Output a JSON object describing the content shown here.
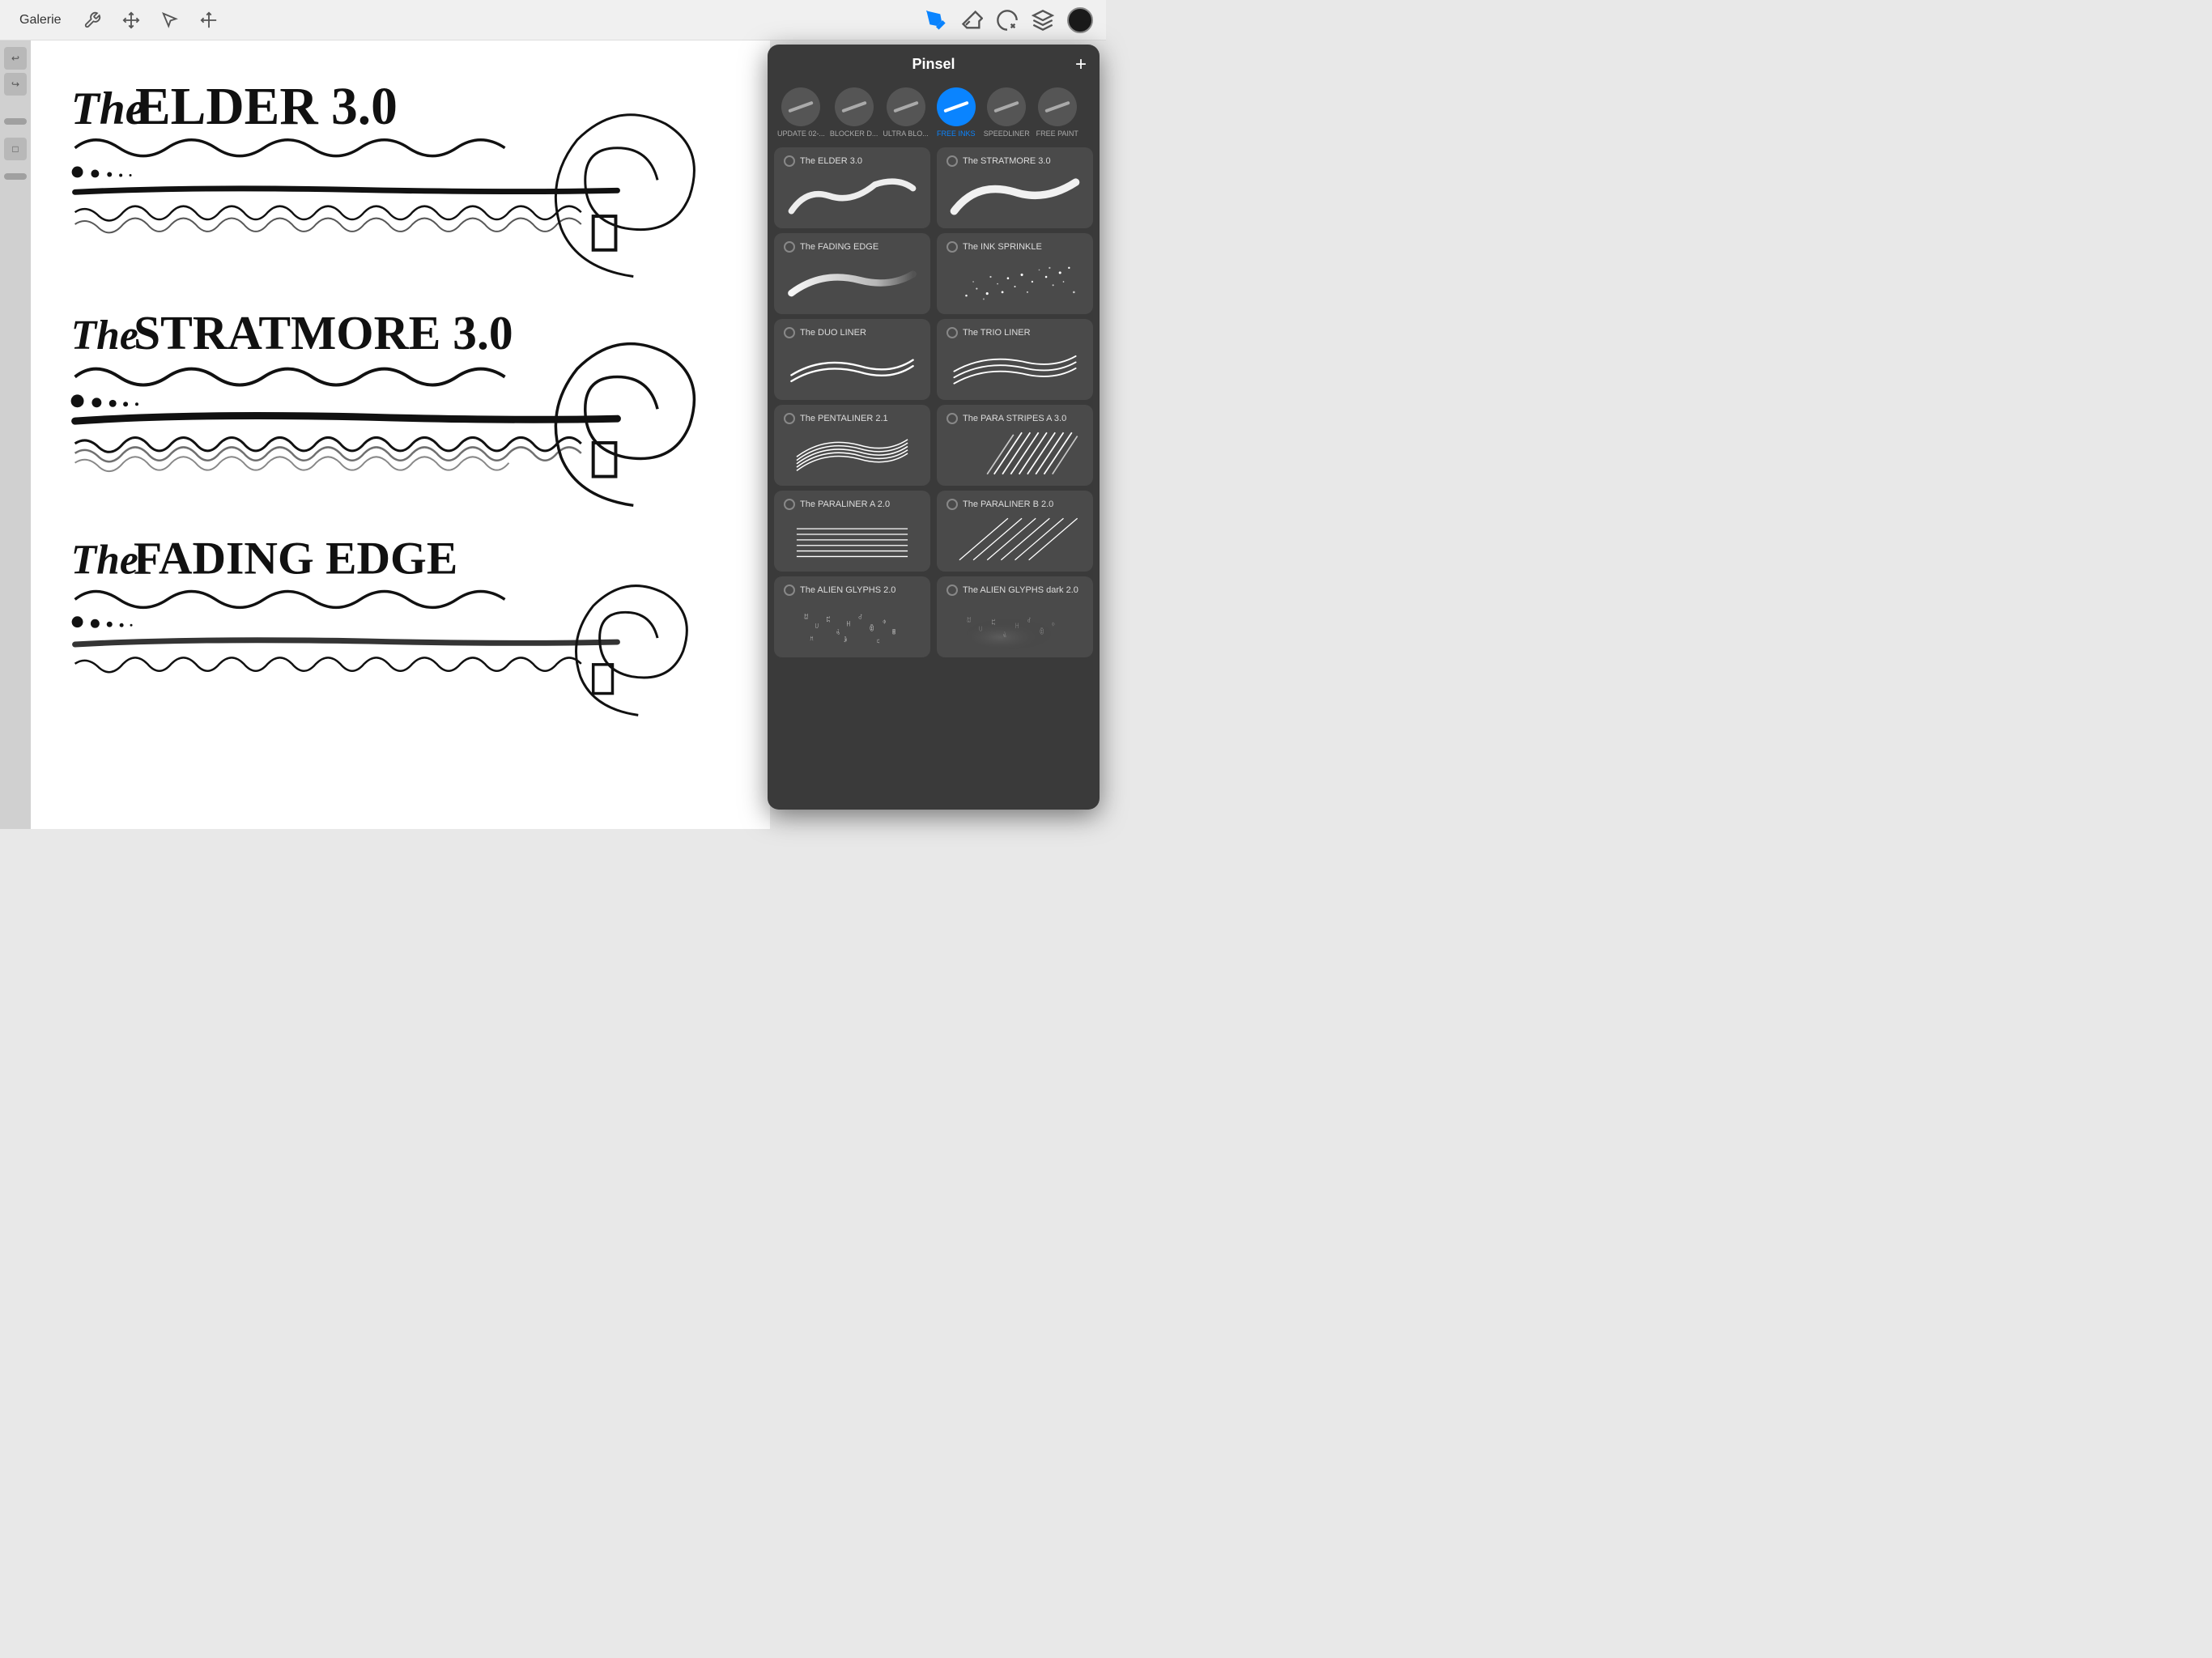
{
  "toolbar": {
    "galerie_label": "Galerie",
    "add_label": "+",
    "title": "Pinsel"
  },
  "tabs": [
    {
      "id": "update",
      "label": "UPDATE 02-...",
      "active": false
    },
    {
      "id": "blocker",
      "label": "BLOCKER D...",
      "active": false
    },
    {
      "id": "ultra",
      "label": "ULTRA BLO...",
      "active": false
    },
    {
      "id": "freeinks",
      "label": "FREE INKS",
      "active": true
    },
    {
      "id": "speedliner",
      "label": "SPEEDLINER",
      "active": false
    },
    {
      "id": "freepaint",
      "label": "FREE PAINT",
      "active": false
    }
  ],
  "brushes": [
    {
      "id": "elder",
      "name": "The ELDER 3.0",
      "col": 0
    },
    {
      "id": "stratmore",
      "name": "The STRATMORE 3.0",
      "col": 1
    },
    {
      "id": "fading",
      "name": "The FADING EDGE",
      "col": 0
    },
    {
      "id": "inksprinkle",
      "name": "The INK SPRINKLE",
      "col": 1
    },
    {
      "id": "duoliner",
      "name": "The DUO LINER",
      "col": 0
    },
    {
      "id": "trioliner",
      "name": "The TRIO LINER",
      "col": 1
    },
    {
      "id": "pentaliner",
      "name": "The PENTALINER 2.1",
      "col": 0
    },
    {
      "id": "parastripes",
      "name": "The PARA STRIPES A 3.0",
      "col": 1
    },
    {
      "id": "paralinerA",
      "name": "The PARALINER A 2.0",
      "col": 0
    },
    {
      "id": "paralinerB",
      "name": "The PARALINER B 2.0",
      "col": 1
    },
    {
      "id": "alienglyphs",
      "name": "The ALIEN GLYPHS 2.0",
      "col": 0
    },
    {
      "id": "alienglyphsdark",
      "name": "The ALIEN GLYPHS dark 2.0",
      "col": 1
    }
  ],
  "canvas": {
    "section1": "The ELDER 3.0",
    "section2": "The STRATMORE 3.0",
    "section3": "The FADING EDGE"
  }
}
